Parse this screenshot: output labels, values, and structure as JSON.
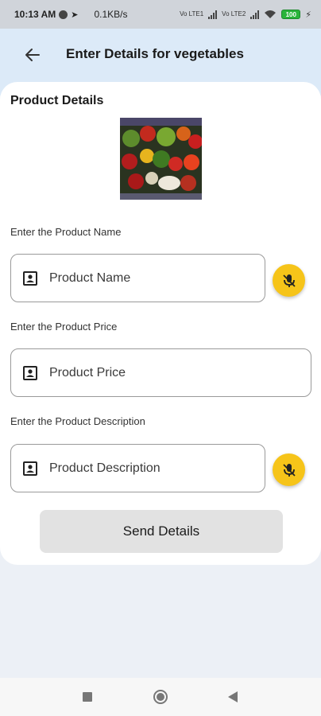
{
  "status_bar": {
    "time": "10:13 AM",
    "speed": "0.1KB/s",
    "volte1": "Vo LTE1",
    "volte2": "Vo LTE2",
    "battery": "100"
  },
  "app_bar": {
    "title": "Enter Details for vegetables"
  },
  "card": {
    "section_title": "Product Details"
  },
  "fields": {
    "name": {
      "label": "Enter the Product Name",
      "placeholder": "Product Name"
    },
    "price": {
      "label": "Enter the Product Price",
      "placeholder": "Product Price"
    },
    "description": {
      "label": "Enter the Product Description",
      "placeholder": "Product Description"
    }
  },
  "send_button": {
    "label": "Send Details"
  },
  "colors": {
    "accent_mic": "#f6c419",
    "header_bg": "#dceaf8",
    "button_bg": "#e2e2e2"
  },
  "icons": {
    "back": "arrow-left-icon",
    "field": "portrait-icon",
    "mic": "mic-off-icon"
  }
}
